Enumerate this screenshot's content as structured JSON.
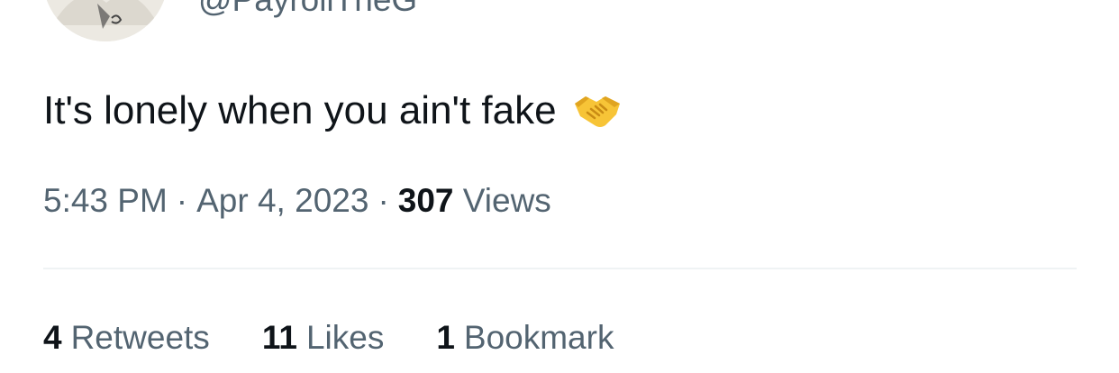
{
  "author": {
    "handle": "@PayrollTheG",
    "avatar_icon": "profile-avatar"
  },
  "tweet": {
    "text": "It's lonely when you ain't fake",
    "emoji_icon": "handshake-emoji-icon"
  },
  "meta": {
    "time": "5:43 PM",
    "separator": "·",
    "date": "Apr 4, 2023",
    "views_count": "307",
    "views_label": "Views"
  },
  "stats": {
    "retweets_count": "4",
    "retweets_label": "Retweets",
    "likes_count": "11",
    "likes_label": "Likes",
    "bookmarks_count": "1",
    "bookmarks_label": "Bookmark"
  },
  "colors": {
    "text_primary": "#0f1419",
    "text_secondary": "#536471",
    "divider": "#eff3f4",
    "emoji_yellow": "#f7c437"
  }
}
